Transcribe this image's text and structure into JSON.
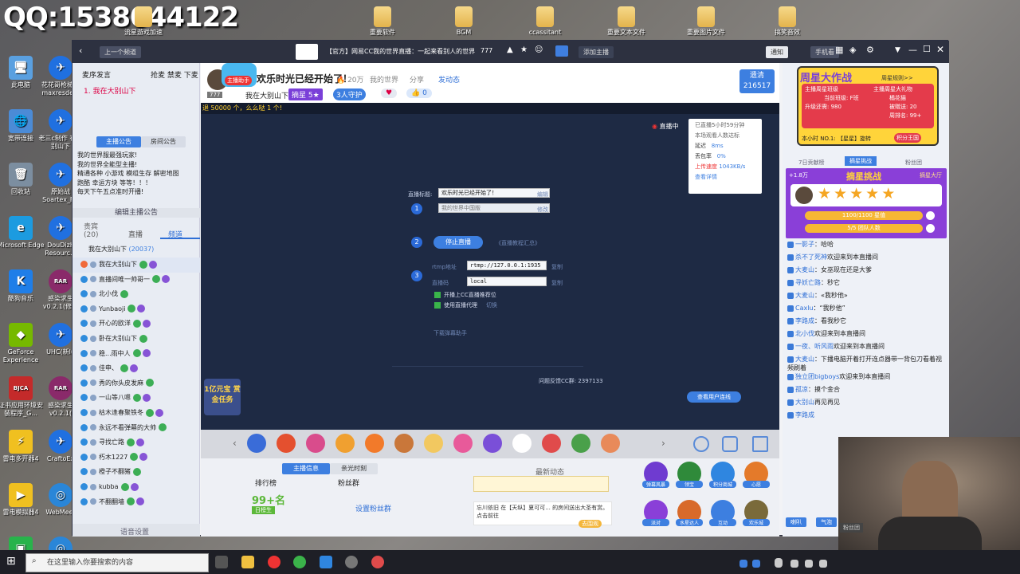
{
  "desktop": {
    "qq": "QQ:1538044122",
    "left_icons": [
      {
        "label": "此电脑",
        "sym": "🖥",
        "color": "#5aa0e0"
      },
      {
        "label": "宽带连接",
        "sym": "🌐",
        "color": "#4b8bd6"
      },
      {
        "label": "回收站",
        "sym": "🗑",
        "color": "#7c8ea0"
      },
      {
        "label": "Microsoft Edge",
        "sym": "e",
        "color": "#1c9be0"
      },
      {
        "label": "酷狗音乐",
        "sym": "K",
        "color": "#1f7ee8"
      },
      {
        "label": "GeForce Experience",
        "sym": "◆",
        "color": "#76b900"
      },
      {
        "label": "证书应用环境安装程序_G...",
        "sym": "BJCA",
        "color": "#c42a2a"
      },
      {
        "label": "雷电多开器4",
        "sym": "⚡",
        "color": "#f0c020"
      },
      {
        "label": "雷电模拟器4",
        "sym": "▶",
        "color": "#f0c020"
      },
      {
        "label": "爱奇艺万能播放器",
        "sym": "▣",
        "color": "#28b34b"
      }
    ],
    "col2_icons": [
      {
        "label": "花花哥枪械轮 maxresde...",
        "sym": "✈",
        "color": "#2070e0"
      },
      {
        "label": "老三c制作 在大别山下",
        "sym": "✈",
        "color": "#2070e0"
      },
      {
        "label": "原始战 Soartex_F...",
        "sym": "✈",
        "color": "#2070e0"
      },
      {
        "label": "DouDizh Resourc...",
        "sym": "✈",
        "color": "#2070e0"
      },
      {
        "label": "感染求生 v0.2.1(修正",
        "sym": "RAR",
        "color": "#8a2a6a"
      },
      {
        "label": "UHC(新lu",
        "sym": "✈",
        "color": "#2070e0"
      },
      {
        "label": "感染求生 v0.2.1(",
        "sym": "RAR",
        "color": "#8a2a6a"
      },
      {
        "label": "CraftoEx",
        "sym": "✈",
        "color": "#2070e0"
      },
      {
        "label": "WebMeet",
        "sym": "◎",
        "color": "#2a86d8"
      },
      {
        "label": "WebMeet",
        "sym": "◎",
        "color": "#2a86d8"
      }
    ],
    "top_folders": [
      "流星游戏加速",
      "重要软件",
      "BGM",
      "ccassitant",
      "重要文本文件",
      "重要图片文件",
      "搞笑音效"
    ]
  },
  "window": {
    "back": "上一个频道",
    "title": "【官方】网易CC我的世界直播：一起来看别人的世界",
    "viewers": "777",
    "add_channel": "添加主播",
    "notify": "通知",
    "phone": "手机看"
  },
  "left": {
    "header_tabs": [
      "麦序发言",
      "抢麦 禁麦 下麦"
    ],
    "queue_item": "1.  我在大别山下",
    "notice_tab": "主播公告",
    "room_tab": "房间公告",
    "announcement": [
      "我的世界服最强玩家!",
      "我的世界全能型主播!",
      "精通各种 小游戏 模组生存 解密地图",
      "跑酷 幸运方块 等等！！！",
      "每天下午五点准时开播!"
    ],
    "edit_notice": "编辑主播公告",
    "tabs": [
      "贵宾 (20)",
      "直播",
      "频道"
    ],
    "channel": "我在大别山下",
    "channel_id": "(20037)",
    "users": [
      "我在大别山下",
      "直播间唯一帅哥一",
      "北小伐",
      "Yunbaoji",
      "开心的欧洋",
      "卧在大别山下",
      "稳...雨中人",
      "佳申、",
      "秀的你头皮发麻",
      "一山等八嗯",
      "枯木逢春聚铁冬",
      "永远不看弹幕的大帅",
      "寻找亡路",
      "朽木1227",
      "橙子不翻猪",
      "kubba",
      "不翻翻墙"
    ],
    "footer": "语音设置"
  },
  "header": {
    "assistant": "主播助手",
    "title": "欢乐时光已经开始了！",
    "hot": "20万",
    "tags": [
      "我的世界",
      "分享"
    ],
    "send_dynamic": "发动态",
    "streamer": "我在大别山下",
    "level_label": "摘星",
    "level_num": "5",
    "guard": "3人守护",
    "like_count": "0",
    "follow_btn": "遗清",
    "follow_count": "216517",
    "marquee": "退 50000 个，么么哒 1 个!"
  },
  "stage": {
    "live_status": "直播中",
    "stats_title": "已直播5小时59分钟",
    "stats_sub": "本场观看人数达标",
    "latency_label": "延迟",
    "latency": "8ms",
    "loss_label": "丢包率",
    "loss": "0%",
    "upload_label": "上传速度",
    "upload": "1043KB/s",
    "detail": "查看详情",
    "title_label": "直播标题:",
    "title_value": "欢乐时光已经开始了！",
    "edit": "编辑",
    "category_value": "我的世界中国版",
    "change": "修改",
    "stop_btn": "停止直播",
    "tutorial": "《直播教程汇总》",
    "rtmp_label": "rtmp地址",
    "rtmp_value": "rtmp://127.0.0.1:1935",
    "copy": "复制",
    "key_label": "直播码",
    "key_value": "local",
    "copy2": "复制",
    "check1": "开播上CC直播推荐位",
    "check2": "使用直播代理",
    "check2_link": "切换",
    "download": "下载弹幕助手",
    "feedback": "问题反馈CC群: 2397133",
    "user_line": "查看用户连线",
    "task": "1亿元宝 赏金任务"
  },
  "bottom": {
    "tabs": [
      "主播信息",
      "亲光时刻"
    ],
    "rank": "排行榜",
    "fans": "粉丝群",
    "score": "99+名",
    "score_badge": "日榜生",
    "fans_btn": "设置粉丝群",
    "dynamic": "最新动态",
    "dynamic_text": "忘川依旧 在【天纵】夏可可... 的房间送出大圣有赏。点击前往",
    "dynamic_btn": "去围观",
    "features": [
      "弹幕风暴",
      "领宝",
      "积分商城",
      "心愿",
      "派对",
      "水星达人",
      "互动",
      "欢乐城"
    ]
  },
  "right": {
    "banner_title": "周星大作战",
    "banner_link": "周星规则>>",
    "rank_label": "主播周星班级",
    "cur_rank": "当前班级: F班",
    "gift_label": "主播周星大礼物",
    "gift_name": "橘花猫",
    "upgrade_label": "升级还需: 980",
    "received": "被赠送: 20",
    "week_rank": "周排名: 99+",
    "hour_no1": "本小时 NO.1:",
    "hour_who": "【星星】旋转",
    "points_btn": "积分王国",
    "tabs": [
      "7日贡献榜",
      "摘星挑战",
      "粉丝团"
    ],
    "challenge_plus": "+1.8万",
    "challenge_title": "摘星挑战",
    "challenge_hall": "摘星大厅",
    "bar1": "1100/1100 星值",
    "bar2": "5/5 团队人数",
    "chat": [
      {
        "n": "一影子",
        "t": "：哈哈"
      },
      {
        "n": "杀不了死神",
        "t": "欢迎来到本直播间"
      },
      {
        "n": "大麦山",
        "t": "：女巫现在还是大爹"
      },
      {
        "n": "寻妖亡路",
        "t": "：秒它"
      },
      {
        "n": "大麦山",
        "t": "：«我秒他»"
      },
      {
        "n": "Caxlu",
        "t": "：“我秒他”"
      },
      {
        "n": "李路成",
        "t": "：看我秒它"
      },
      {
        "n": "北小伐",
        "t": "欢迎来到本直播间"
      },
      {
        "n": "一夜、听风雨",
        "t": "欢迎来到本直播间"
      },
      {
        "n": "大麦山",
        "t": "：下播电脑开着打开连点器带一背包刀看着视频刷着"
      },
      {
        "n": "独立团bigboys",
        "t": "欢迎来到本直播间"
      },
      {
        "n": "孤凉",
        "t": "：摸个金合"
      },
      {
        "n": "大别山",
        "t": "再见再见"
      },
      {
        "n": "李路成",
        "t": ""
      }
    ],
    "chat_tools": [
      "喇叭",
      "气泡"
    ],
    "fans_club": "粉丝团"
  },
  "taskbar": {
    "search": "在这里输入你要搜索的内容"
  }
}
